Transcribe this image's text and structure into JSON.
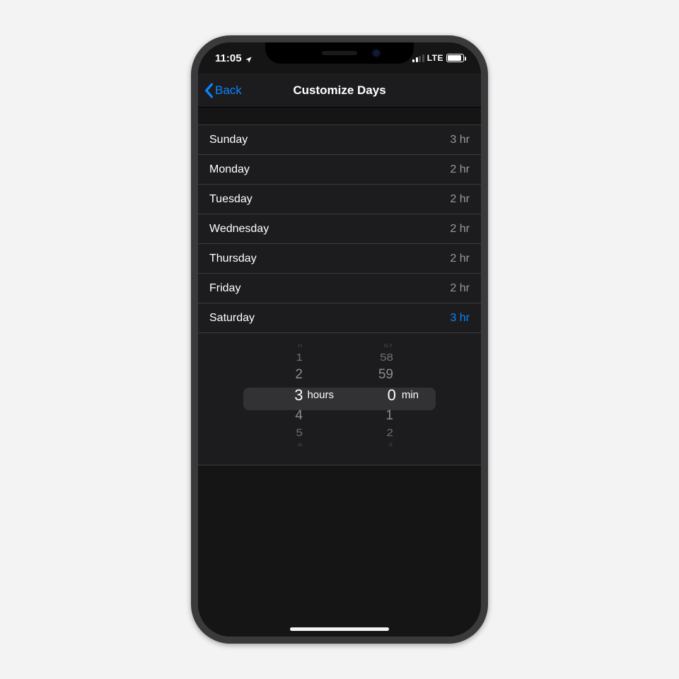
{
  "status": {
    "time": "11:05",
    "network": "LTE"
  },
  "nav": {
    "back": "Back",
    "title": "Customize Days"
  },
  "days": [
    {
      "name": "Sunday",
      "value": "3 hr"
    },
    {
      "name": "Monday",
      "value": "2 hr"
    },
    {
      "name": "Tuesday",
      "value": "2 hr"
    },
    {
      "name": "Wednesday",
      "value": "2 hr"
    },
    {
      "name": "Thursday",
      "value": "2 hr"
    },
    {
      "name": "Friday",
      "value": "2 hr"
    },
    {
      "name": "Saturday",
      "value": "3 hr"
    }
  ],
  "selected_day_index": 6,
  "picker": {
    "hours_unit": "hours",
    "min_unit": "min",
    "hours": {
      "far_above": "0",
      "above2": "1",
      "above1": "2",
      "selected": "3",
      "below1": "4",
      "below2": "5",
      "far_below": "6"
    },
    "minutes": {
      "far_above": "57",
      "above2": "58",
      "above1": "59",
      "selected": "0",
      "below1": "1",
      "below2": "2",
      "far_below": "3"
    }
  },
  "colors": {
    "accent": "#0a84ff"
  }
}
